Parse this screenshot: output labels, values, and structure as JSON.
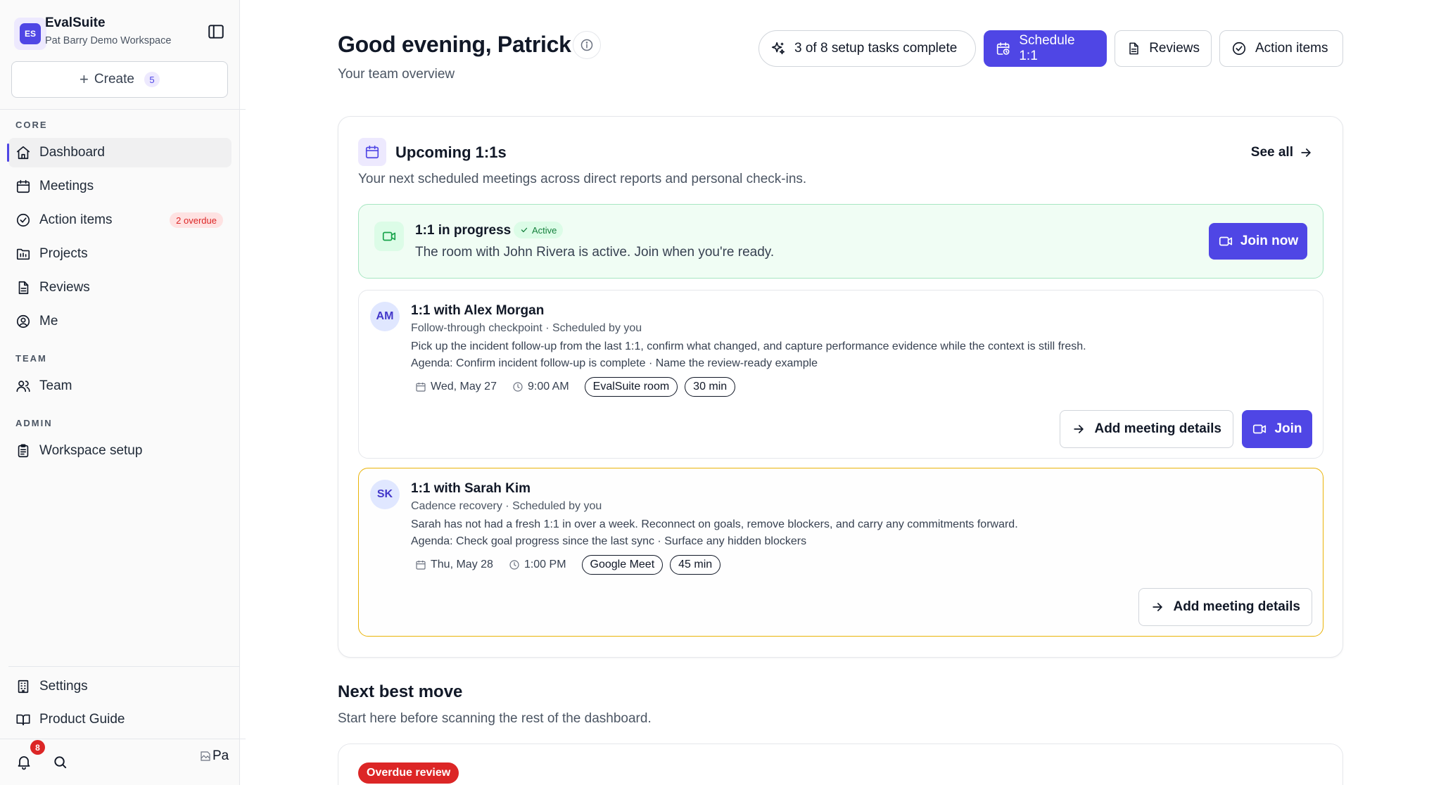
{
  "workspace": {
    "logo_text": "ES",
    "name": "EvalSuite",
    "subtitle": "Pat Barry Demo Workspace"
  },
  "create": {
    "label": "Create",
    "count": "5"
  },
  "sections": {
    "core": "CORE",
    "team": "TEAM",
    "admin": "ADMIN"
  },
  "nav": {
    "dashboard": "Dashboard",
    "meetings": "Meetings",
    "action_items": "Action items",
    "action_items_badge": "2 overdue",
    "projects": "Projects",
    "reviews": "Reviews",
    "me": "Me",
    "team": "Team",
    "workspace_setup": "Workspace setup",
    "settings": "Settings",
    "product_guide": "Product Guide"
  },
  "footer": {
    "notification_count": "8",
    "avatar_alt": "Pa"
  },
  "header": {
    "greeting": "Good evening, Patrick",
    "subtitle": "Your team overview",
    "setup_progress": "3 of 8 setup tasks complete",
    "schedule_label": "Schedule 1:1",
    "reviews_label": "Reviews",
    "action_items_label": "Action items"
  },
  "upcoming": {
    "title": "Upcoming 1:1s",
    "subtitle": "Your next scheduled meetings across direct reports and personal check-ins.",
    "see_all": "See all",
    "live": {
      "title": "1:1 in progress",
      "status": "Active",
      "description": "The room with John Rivera is active. Join when you're ready.",
      "join_label": "Join now"
    },
    "meetings": [
      {
        "initials": "AM",
        "title": "1:1 with Alex Morgan",
        "meta": "Follow-through checkpoint · Scheduled by you",
        "description": "Pick up the incident follow-up from the last 1:1, confirm what changed, and capture performance evidence while the context is still fresh.",
        "agenda": "Agenda: Confirm incident follow-up is complete · Name the review-ready example",
        "date": "Wed, May 27",
        "time": "9:00 AM",
        "location": "EvalSuite room",
        "duration": "30 min",
        "details_label": "Add meeting details",
        "join_label": "Join"
      },
      {
        "initials": "SK",
        "title": "1:1 with Sarah Kim",
        "meta": "Cadence recovery · Scheduled by you",
        "description": "Sarah has not had a fresh 1:1 in over a week. Reconnect on goals, remove blockers, and carry any commitments forward.",
        "agenda": "Agenda: Check goal progress since the last sync · Surface any hidden blockers",
        "date": "Thu, May 28",
        "time": "1:00 PM",
        "location": "Google Meet",
        "duration": "45 min",
        "details_label": "Add meeting details"
      }
    ]
  },
  "next_best_move": {
    "title": "Next best move",
    "subtitle": "Start here before scanning the rest of the dashboard.",
    "badge": "Overdue review"
  },
  "colors": {
    "accent": "#4f46e5",
    "live_bg": "#f0fdf4",
    "live_border": "#a7e6c2",
    "warn_border": "#eab308",
    "danger": "#dc2626"
  }
}
